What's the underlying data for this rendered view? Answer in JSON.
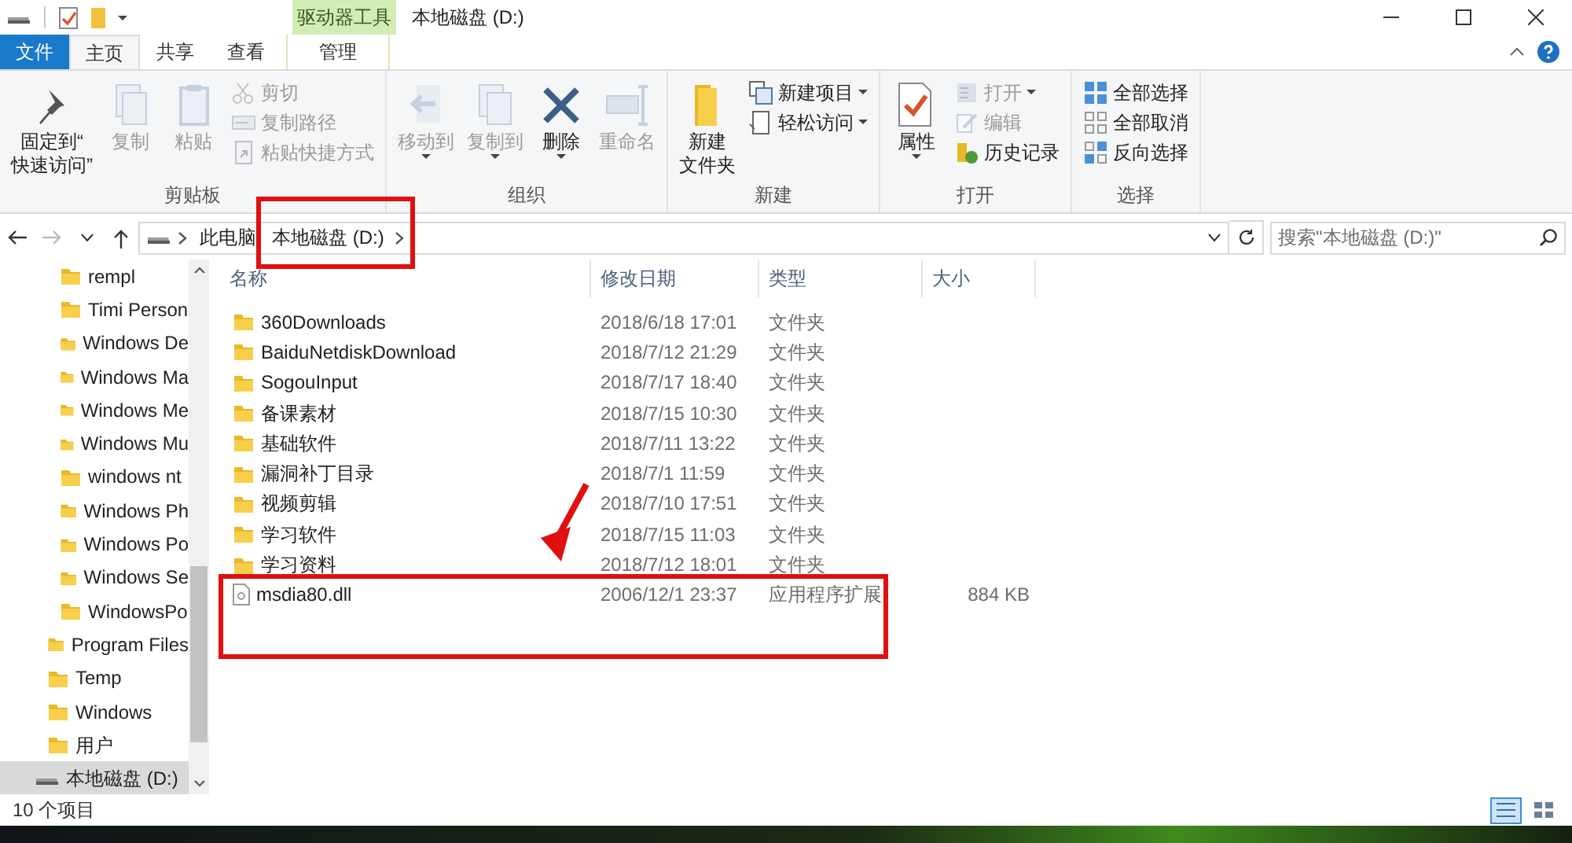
{
  "window": {
    "title": "本地磁盘 (D:)",
    "contextual_tab": "驱动器工具"
  },
  "tabs": [
    {
      "label": "文件",
      "kind": "file",
      "selected": false
    },
    {
      "label": "主页",
      "kind": "normal",
      "selected": true
    },
    {
      "label": "共享",
      "kind": "normal",
      "selected": false
    },
    {
      "label": "查看",
      "kind": "normal",
      "selected": false
    },
    {
      "label": "管理",
      "kind": "contextual",
      "selected": false
    }
  ],
  "ribbon": [
    {
      "label": "剪贴板",
      "items": [
        {
          "kind": "large",
          "label_lines": [
            "固定到“",
            "快速访问”"
          ],
          "disabled": false
        },
        {
          "kind": "large",
          "label": "复制",
          "disabled": true
        },
        {
          "kind": "large",
          "label": "粘贴",
          "disabled": true
        },
        {
          "kind": "small",
          "label": "剪切",
          "disabled": true
        },
        {
          "kind": "small",
          "label": "复制路径",
          "disabled": true
        },
        {
          "kind": "small",
          "label": "粘贴快捷方式",
          "disabled": true
        }
      ]
    },
    {
      "label": "组织",
      "items": [
        {
          "kind": "large",
          "label": "移动到",
          "disabled": true,
          "dropdown": true
        },
        {
          "kind": "large",
          "label": "复制到",
          "disabled": true,
          "dropdown": true
        },
        {
          "kind": "large",
          "label": "删除",
          "disabled": false,
          "dropdown": true
        },
        {
          "kind": "large",
          "label": "重命名",
          "disabled": true
        }
      ]
    },
    {
      "label": "新建",
      "items": [
        {
          "kind": "large",
          "label_lines": [
            "新建",
            "文件夹"
          ],
          "disabled": false
        },
        {
          "kind": "small",
          "label": "新建项目",
          "disabled": false,
          "dropdown": true
        },
        {
          "kind": "small",
          "label": "轻松访问",
          "disabled": false,
          "dropdown": true
        }
      ]
    },
    {
      "label": "打开",
      "items": [
        {
          "kind": "large",
          "label": "属性",
          "disabled": false,
          "dropdown": true
        },
        {
          "kind": "small",
          "label": "打开",
          "disabled": true,
          "dropdown": true
        },
        {
          "kind": "small",
          "label": "编辑",
          "disabled": true
        },
        {
          "kind": "small",
          "label": "历史记录",
          "disabled": false
        }
      ]
    },
    {
      "label": "选择",
      "items": [
        {
          "kind": "small",
          "label": "全部选择",
          "disabled": false
        },
        {
          "kind": "small",
          "label": "全部取消",
          "disabled": false
        },
        {
          "kind": "small",
          "label": "反向选择",
          "disabled": false
        }
      ]
    }
  ],
  "address": {
    "crumbs": [
      {
        "label": "此电脑"
      },
      {
        "label": "本地磁盘 (D:)",
        "annotated": true
      }
    ],
    "search_placeholder": "搜索\"本地磁盘 (D:)\""
  },
  "nav_pane": {
    "items": [
      {
        "children": [
          {
            "children": [
              {
                "label": "rempl",
                "selected": false
              },
              {
                "label": "Timi Person",
                "selected": false
              },
              {
                "label": "Windows De",
                "selected": false
              },
              {
                "label": "Windows Ma",
                "selected": false
              },
              {
                "label": "Windows Me",
                "selected": false
              },
              {
                "label": "Windows Mu",
                "selected": false
              },
              {
                "label": "windows nt",
                "selected": false
              },
              {
                "label": "Windows Ph",
                "selected": false
              },
              {
                "label": "Windows Po",
                "selected": false
              },
              {
                "label": "Windows Se",
                "selected": false
              },
              {
                "label": "WindowsPo",
                "selected": false
              }
            ]
          },
          {
            "label": "Program Files",
            "selected": false
          },
          {
            "label": "Temp",
            "selected": false
          },
          {
            "label": "Windows",
            "selected": false
          },
          {
            "label": "用户",
            "selected": false
          }
        ]
      },
      {
        "label": "本地磁盘 (D:)",
        "kind": "drive",
        "selected": true
      }
    ]
  },
  "table": {
    "columns": [
      "名称",
      "修改日期",
      "类型",
      "大小"
    ],
    "rows": [
      {
        "kind": "folder",
        "name": "360Downloads",
        "date": "2018/6/18 17:01",
        "type": "文件夹"
      },
      {
        "kind": "folder",
        "name": "BaiduNetdiskDownload",
        "date": "2018/7/12 21:29",
        "type": "文件夹"
      },
      {
        "kind": "folder",
        "name": "SogouInput",
        "date": "2018/7/17 18:40",
        "type": "文件夹"
      },
      {
        "kind": "folder",
        "name": "备课素材",
        "date": "2018/7/15 10:30",
        "type": "文件夹"
      },
      {
        "kind": "folder",
        "name": "基础软件",
        "date": "2018/7/11 13:22",
        "type": "文件夹"
      },
      {
        "kind": "folder",
        "name": "漏洞补丁目录",
        "date": "2018/7/1 11:59",
        "type": "文件夹"
      },
      {
        "kind": "folder",
        "name": "视频剪辑",
        "date": "2018/7/10 17:51",
        "type": "文件夹"
      },
      {
        "kind": "folder",
        "name": "学习软件",
        "date": "2018/7/15 11:03",
        "type": "文件夹"
      },
      {
        "kind": "folder",
        "name": "学习资料",
        "date": "2018/7/12 18:01",
        "type": "文件夹"
      },
      {
        "kind": "file",
        "name": "msdia80.dll",
        "date": "2006/12/1 23:37",
        "type": "应用程序扩展",
        "size": "884 KB",
        "annotated": true
      }
    ]
  },
  "annotations": [
    {
      "kind": "arrow"
    }
  ],
  "status_bar": {
    "count": "10 个项目"
  }
}
